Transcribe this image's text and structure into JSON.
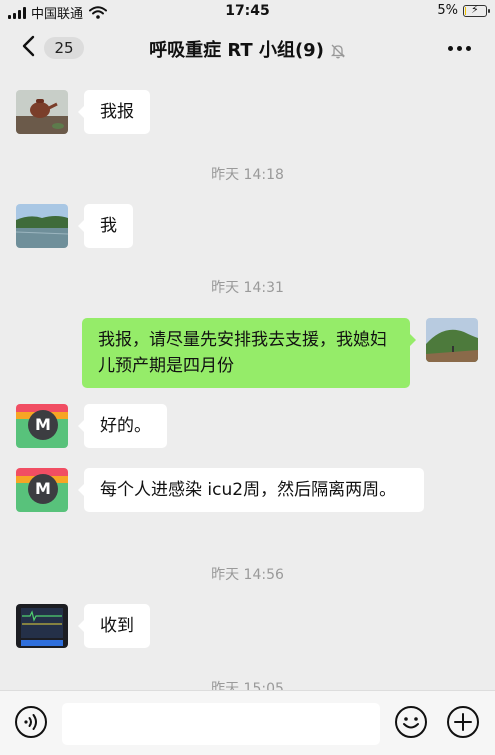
{
  "status_bar": {
    "carrier": "中国联通",
    "time": "17:45",
    "battery_percent_label": "5%",
    "battery_level": 0.05
  },
  "header": {
    "back_count": "25",
    "title": "呼吸重症 RT 小组(9)"
  },
  "messages": [
    {
      "type": "message",
      "side": "left",
      "avatar": "teapot-photo",
      "text": "我报"
    },
    {
      "type": "time",
      "text": "昨天 14:18"
    },
    {
      "type": "message",
      "side": "left",
      "avatar": "lake-photo",
      "text": "我"
    },
    {
      "type": "time",
      "text": "昨天 14:31"
    },
    {
      "type": "message",
      "side": "right",
      "avatar": "hill-photo",
      "text": "我报，请尽量先安排我去支援，我媳妇儿预产期是四月份"
    },
    {
      "type": "message",
      "side": "left",
      "avatar": "m-logo",
      "text": "好的。"
    },
    {
      "type": "message",
      "side": "left",
      "avatar": "m-logo",
      "text": "每个人进感染 icu2周，然后隔离两周。"
    },
    {
      "type": "time",
      "text": "昨天 14:56"
    },
    {
      "type": "message",
      "side": "left",
      "avatar": "monitor-photo",
      "text": "收到"
    },
    {
      "type": "time",
      "text": "昨天 15:05"
    }
  ],
  "avatar_logo_text": "M",
  "input_bar": {
    "voice_icon": "voice-icon",
    "emoji_icon": "emoji-icon",
    "add_icon": "plus-icon"
  },
  "colors": {
    "background": "#ededed",
    "own_bubble": "#95ec69",
    "other_bubble": "#ffffff",
    "timestamp": "#9a9a9a"
  }
}
